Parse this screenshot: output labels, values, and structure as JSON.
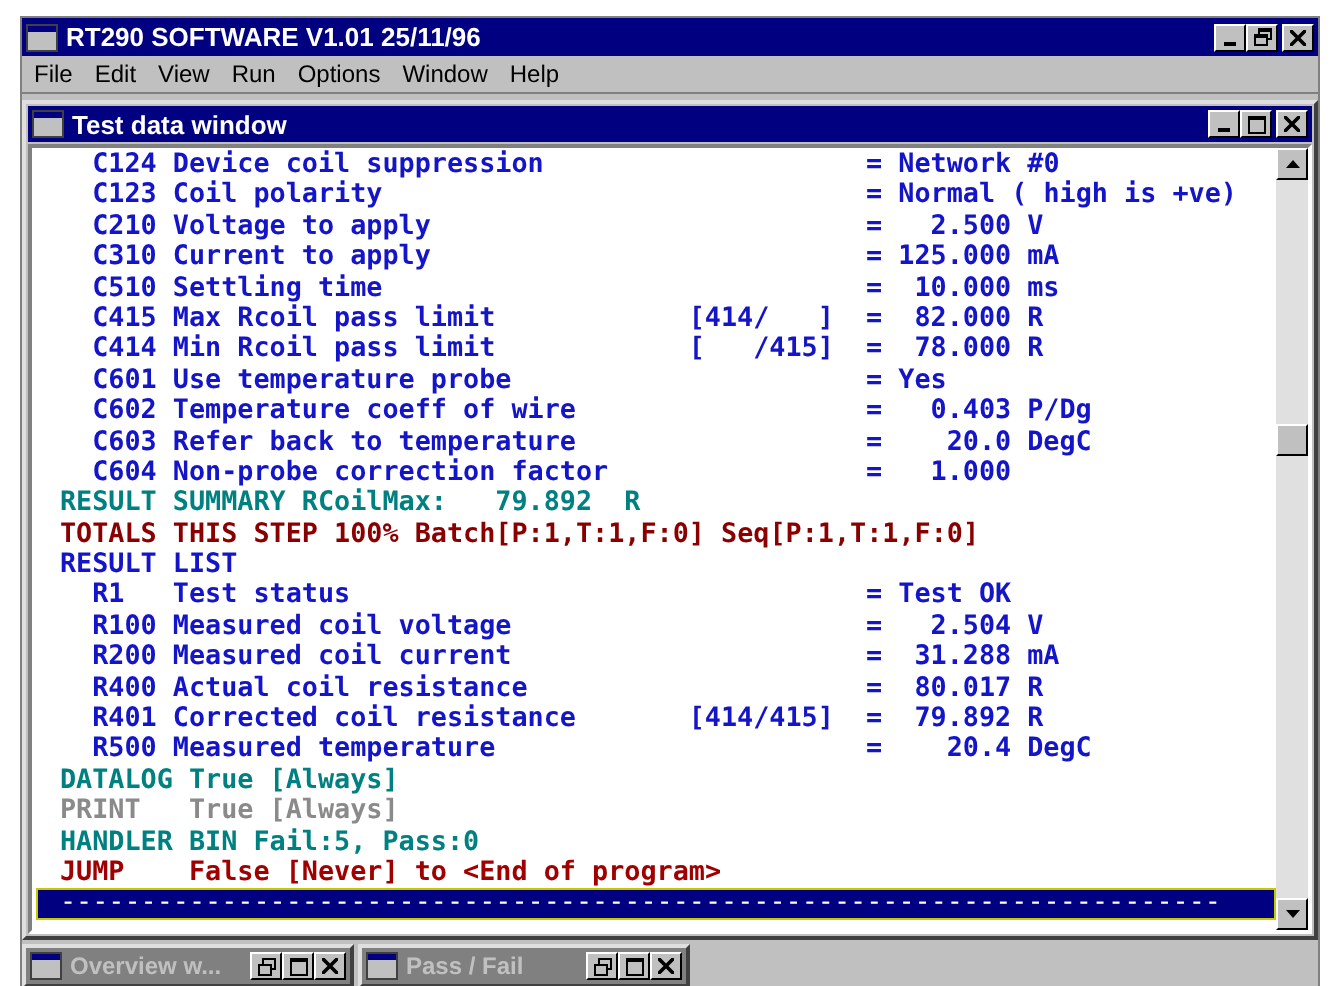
{
  "app": {
    "title": "RT290 SOFTWARE V1.01 25/11/96",
    "menu": [
      "File",
      "Edit",
      "View",
      "Run",
      "Options",
      "Window",
      "Help"
    ]
  },
  "child": {
    "title": "Test data window",
    "lines": [
      {
        "kind": "param",
        "selected": false,
        "code": "C124",
        "label": "Device coil suppression",
        "eq": "=",
        "value": "Network #0"
      },
      {
        "kind": "param",
        "selected": false,
        "code": "C123",
        "label": "Coil polarity",
        "eq": "=",
        "value": "Normal ( high is +ve)"
      },
      {
        "kind": "number",
        "selected": false,
        "code": "C210",
        "label": "Voltage to apply",
        "eq": "=",
        "value": "2.500",
        "unit": "V"
      },
      {
        "kind": "number",
        "selected": false,
        "code": "C310",
        "label": "Current to apply",
        "eq": "=",
        "value": "125.000",
        "unit": "mA"
      },
      {
        "kind": "number",
        "selected": false,
        "code": "C510",
        "label": "Settling time",
        "eq": "=",
        "value": "10.000",
        "unit": "ms"
      },
      {
        "kind": "number",
        "selected": false,
        "code": "C415",
        "label": "Max Rcoil pass limit",
        "range": "[414/   ]",
        "eq": "=",
        "value": "82.000",
        "unit": "R"
      },
      {
        "kind": "number",
        "selected": false,
        "code": "C414",
        "label": "Min Rcoil pass limit",
        "range": "[   /415]",
        "eq": "=",
        "value": "78.000",
        "unit": "R"
      },
      {
        "kind": "param",
        "selected": false,
        "code": "C601",
        "label": "Use temperature probe",
        "eq": "=",
        "value": "Yes"
      },
      {
        "kind": "number",
        "selected": false,
        "code": "C602",
        "label": "Temperature coeff of wire",
        "eq": "=",
        "value": "0.403",
        "unit": "P/Dg"
      },
      {
        "kind": "number",
        "selected": false,
        "code": "C603",
        "label": "Refer back to temperature",
        "eq": "=",
        "value": "20.0",
        "unit": "DegC"
      },
      {
        "kind": "number",
        "selected": false,
        "code": "C604",
        "label": "Non-probe correction factor",
        "eq": "=",
        "value": "1.000"
      },
      {
        "kind": "summary",
        "selected": false,
        "keyword": "RESULT",
        "text": "SUMMARY RCoilMax:",
        "value": "79.892",
        "unit": "R"
      },
      {
        "kind": "totals",
        "selected": false,
        "keyword": "TOTALS",
        "text": "THIS STEP 100% Batch[P:1,T:1,F:0] Seq[P:1,T:1,F:0]"
      },
      {
        "kind": "heading",
        "selected": false,
        "keyword": "RESULT",
        "text": "LIST"
      },
      {
        "kind": "param",
        "selected": false,
        "code": "R1",
        "label": "Test status",
        "eq": "=",
        "value": "Test OK"
      },
      {
        "kind": "number",
        "selected": false,
        "code": "R100",
        "label": "Measured coil voltage",
        "eq": "=",
        "value": "2.504",
        "unit": "V"
      },
      {
        "kind": "number",
        "selected": false,
        "code": "R200",
        "label": "Measured coil current",
        "eq": "=",
        "value": "31.288",
        "unit": "mA"
      },
      {
        "kind": "number",
        "selected": false,
        "code": "R400",
        "label": "Actual coil resistance",
        "eq": "=",
        "value": "80.017",
        "unit": "R"
      },
      {
        "kind": "number",
        "selected": false,
        "code": "R401",
        "label": "Corrected coil resistance",
        "range": "[414/415]",
        "eq": "=",
        "value": "79.892",
        "unit": "R"
      },
      {
        "kind": "number",
        "selected": false,
        "code": "R500",
        "label": "Measured temperature",
        "eq": "=",
        "value": "20.4",
        "unit": "DegC"
      },
      {
        "kind": "datalog",
        "selected": false,
        "keyword": "DATALOG",
        "text": "True [Always]"
      },
      {
        "kind": "print",
        "selected": false,
        "keyword": "PRINT",
        "text": "True [Always]"
      },
      {
        "kind": "handler",
        "selected": false,
        "keyword": "HANDLER",
        "text": "BIN Fail:5, Pass:0"
      },
      {
        "kind": "jump",
        "selected": false,
        "keyword": "JUMP",
        "text": "False [Never] to <End of program>"
      },
      {
        "kind": "separator",
        "selected": true,
        "text": "------------------------------------------------------------------------"
      }
    ]
  },
  "minimized": [
    {
      "title": "Overview w..."
    },
    {
      "title": "Pass / Fail"
    }
  ]
}
